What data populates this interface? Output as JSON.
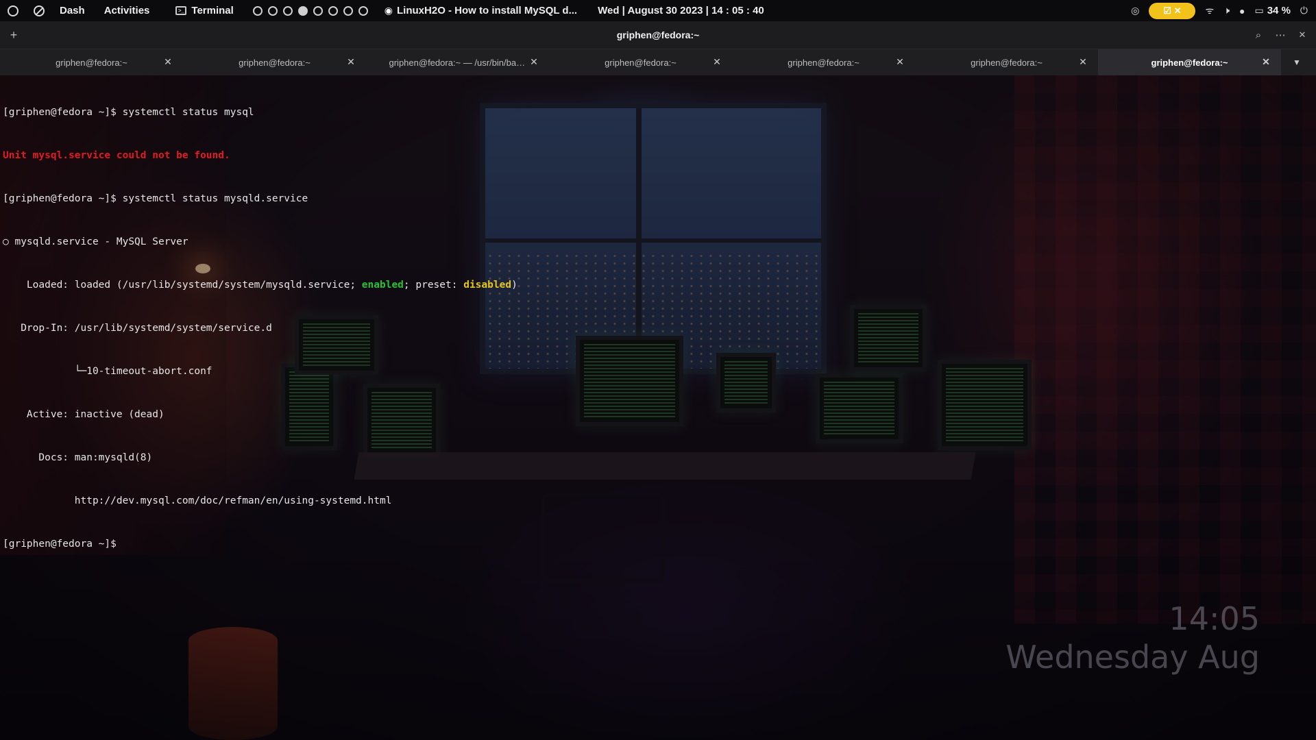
{
  "topbar": {
    "dash_label": "Dash",
    "activities_label": "Activities",
    "app_label": "Terminal",
    "workspaces": [
      {
        "active": false
      },
      {
        "active": false
      },
      {
        "active": false
      },
      {
        "active": true
      },
      {
        "active": false
      },
      {
        "active": false
      },
      {
        "active": false
      },
      {
        "active": false
      }
    ],
    "media_title": "LinuxH2O - How to install MySQL d...",
    "datetime": "Wed | August 30 2023 | 14 : 05 : 40",
    "battery": "34 %",
    "accent_color": "#f2c21b"
  },
  "window": {
    "title": "griphen@fedora:~",
    "new_tab_glyph": "+",
    "search_icon": "search-icon",
    "menu_icon": "more-icon",
    "close_glyph": "✕"
  },
  "tabs": [
    {
      "label": "griphen@fedora:~",
      "active": false
    },
    {
      "label": "griphen@fedora:~",
      "active": false
    },
    {
      "label": "griphen@fedora:~ — /usr/bin/bash ...",
      "active": false
    },
    {
      "label": "griphen@fedora:~",
      "active": false
    },
    {
      "label": "griphen@fedora:~",
      "active": false
    },
    {
      "label": "griphen@fedora:~",
      "active": false
    },
    {
      "label": "griphen@fedora:~",
      "active": true
    }
  ],
  "terminal": {
    "line1": "[griphen@fedora ~]$ systemctl status mysql",
    "line2_error": "Unit mysql.service could not be found.",
    "line3": "[griphen@fedora ~]$ systemctl status mysqld.service",
    "line4": "○ mysqld.service - MySQL Server",
    "line5_pre": "    Loaded: loaded (/usr/lib/systemd/system/mysqld.service; ",
    "line5_enabled": "enabled",
    "line5_mid": "; preset: ",
    "line5_disabled": "disabled",
    "line5_post": ")",
    "line6": "   Drop-In: /usr/lib/systemd/system/service.d",
    "line7": "            └─10-timeout-abort.conf",
    "line8": "    Active: inactive (dead)",
    "line9": "      Docs: man:mysqld(8)",
    "line10": "            http://dev.mysql.com/doc/refman/en/using-systemd.html",
    "line11": "[griphen@fedora ~]$ "
  },
  "desktop_clock": {
    "time": "14:05",
    "date": "Wednesday Aug"
  }
}
